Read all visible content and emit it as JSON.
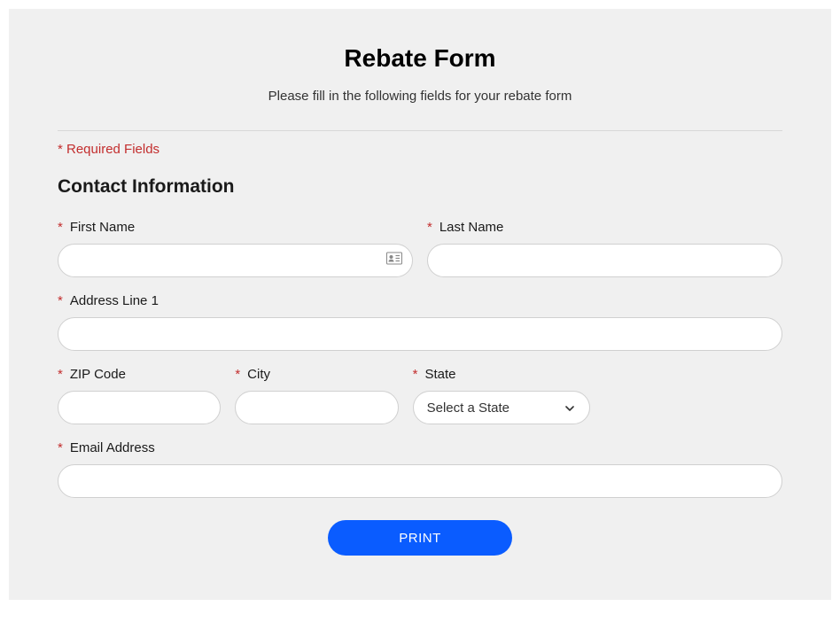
{
  "header": {
    "title": "Rebate Form",
    "subtitle": "Please fill in the following fields for your rebate form"
  },
  "required_note": "* Required Fields",
  "section_title": "Contact Information",
  "asterisk": "*",
  "fields": {
    "first_name": {
      "label": "First Name",
      "value": ""
    },
    "last_name": {
      "label": "Last Name",
      "value": ""
    },
    "address1": {
      "label": "Address Line 1",
      "value": ""
    },
    "zip": {
      "label": "ZIP Code",
      "value": ""
    },
    "city": {
      "label": "City",
      "value": ""
    },
    "state": {
      "label": "State",
      "placeholder": "Select a State",
      "value": ""
    },
    "email": {
      "label": "Email Address",
      "value": ""
    }
  },
  "buttons": {
    "print": "PRINT"
  }
}
